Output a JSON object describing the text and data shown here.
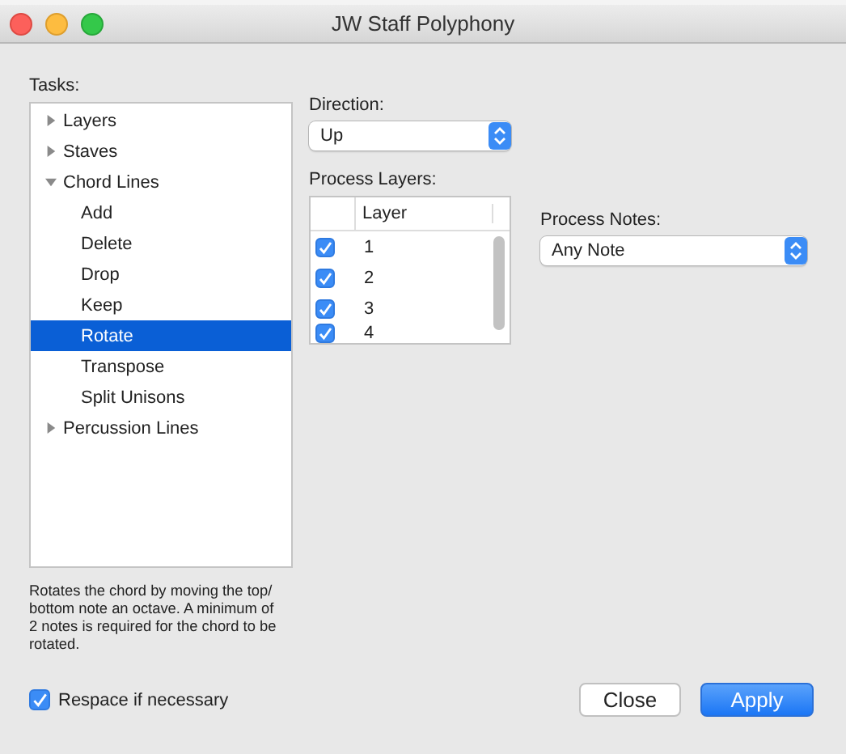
{
  "window": {
    "title": "JW Staff Polyphony"
  },
  "tasks": {
    "label": "Tasks:",
    "items": [
      {
        "label": "Layers",
        "expanded": false,
        "selected": false
      },
      {
        "label": "Staves",
        "expanded": false,
        "selected": false
      },
      {
        "label": "Chord Lines",
        "expanded": true,
        "selected": false,
        "children": [
          {
            "label": "Add",
            "selected": false
          },
          {
            "label": "Delete",
            "selected": false
          },
          {
            "label": "Drop",
            "selected": false
          },
          {
            "label": "Keep",
            "selected": false
          },
          {
            "label": "Rotate",
            "selected": true
          },
          {
            "label": "Transpose",
            "selected": false
          },
          {
            "label": "Split Unisons",
            "selected": false
          }
        ]
      },
      {
        "label": "Percussion Lines",
        "expanded": false,
        "selected": false
      }
    ]
  },
  "description": "Rotates the chord by moving the top/ bottom note an octave. A minimum of 2 notes is required for the chord to be rotated.",
  "direction": {
    "label": "Direction:",
    "value": "Up"
  },
  "process_layers": {
    "label": "Process Layers:",
    "column": "Layer",
    "rows": [
      {
        "label": "1",
        "checked": true
      },
      {
        "label": "2",
        "checked": true
      },
      {
        "label": "3",
        "checked": true
      },
      {
        "label": "4",
        "checked": true
      }
    ]
  },
  "process_notes": {
    "label": "Process Notes:",
    "value": "Any Note"
  },
  "respace": {
    "label": "Respace if necessary",
    "checked": true
  },
  "buttons": [
    {
      "label": "Close",
      "kind": "secondary"
    },
    {
      "label": "Apply",
      "kind": "primary"
    }
  ]
}
